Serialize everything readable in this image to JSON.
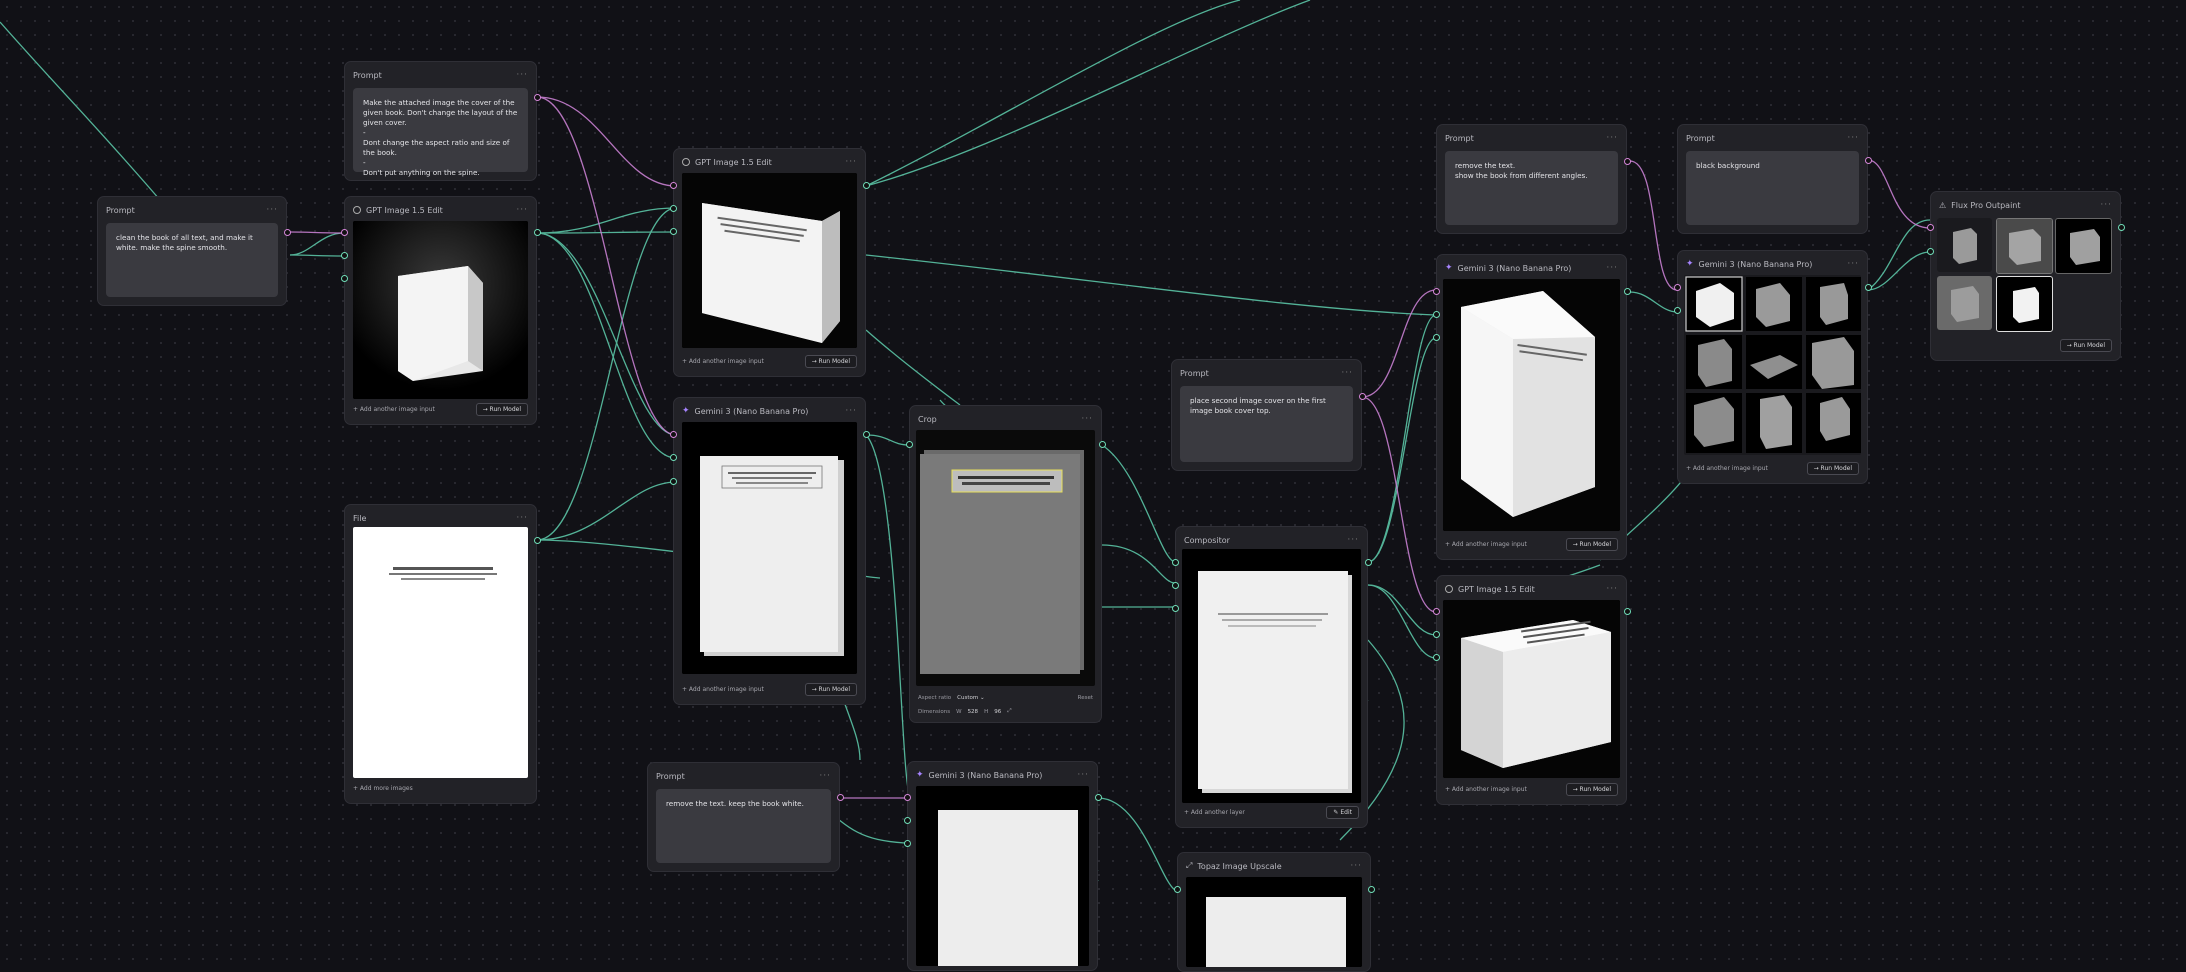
{
  "nodes": {
    "prompt_clean": {
      "title": "Prompt",
      "text": "clean the book of all text, and make it white. make the spine smooth."
    },
    "prompt_cover": {
      "title": "Prompt",
      "text": "Make the attached image the cover of the given book. Don't change the layout of the given cover.\n-\nDont change the aspect ratio and size of the book.\n-\nDon't put anything on the spine."
    },
    "gpt1": {
      "title": "GPT Image 1.5 Edit",
      "add": "+ Add another image input",
      "run": "→ Run Model"
    },
    "file": {
      "title": "File",
      "add": "+ Add more images"
    },
    "gpt2": {
      "title": "GPT Image 1.5 Edit",
      "add": "+ Add another image input",
      "run": "→ Run Model"
    },
    "gem1": {
      "title": "Gemini 3 (Nano Banana Pro)",
      "add": "+ Add another image input",
      "run": "→ Run Model"
    },
    "prompt_remove": {
      "title": "Prompt",
      "text": "remove the text. keep the book white."
    },
    "crop": {
      "title": "Crop",
      "aspect_label": "Aspect ratio",
      "aspect_value": "Custom",
      "reset": "Reset",
      "dim_label": "Dimensions",
      "w_label": "W",
      "w": "528",
      "h_label": "H",
      "h": "96"
    },
    "gem2": {
      "title": "Gemini 3 (Nano Banana Pro)"
    },
    "prompt_place": {
      "title": "Prompt",
      "text": "place second image cover on the first image book cover top."
    },
    "compositor": {
      "title": "Compositor",
      "add": "+ Add another layer",
      "edit": "Edit"
    },
    "topaz": {
      "title": "Topaz Image Upscale"
    },
    "prompt_angles": {
      "title": "Prompt",
      "text": "remove the text.\nshow the book from different angles."
    },
    "gem3": {
      "title": "Gemini 3 (Nano Banana Pro)",
      "add": "+ Add another image input",
      "run": "→ Run Model"
    },
    "gpt3": {
      "title": "GPT Image 1.5 Edit",
      "add": "+ Add another image input",
      "run": "→ Run Model"
    },
    "prompt_black": {
      "title": "Prompt",
      "text": "black background"
    },
    "gem4": {
      "title": "Gemini 3 (Nano Banana Pro)",
      "add": "+ Add another image input",
      "run": "→ Run Model"
    },
    "flux": {
      "title": "Flux Pro Outpaint",
      "run": "→ Run Model"
    }
  },
  "colors": {
    "prompt_wire": "#c77fd0",
    "image_wire": "#5fcfae",
    "background": "#111116",
    "node": "#222227"
  },
  "icons": [
    "gear-icon",
    "sparkle-icon",
    "triangle-icon",
    "expand-icon",
    "more-icon"
  ]
}
